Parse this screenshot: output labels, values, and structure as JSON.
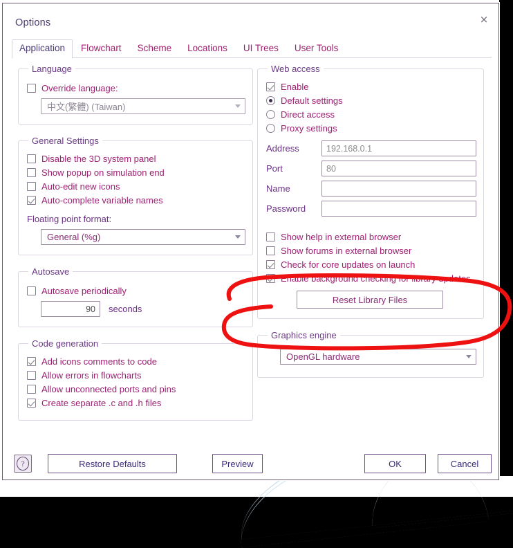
{
  "window": {
    "title": "Options",
    "close_label": "×"
  },
  "tabs": [
    {
      "label": "Application",
      "active": true
    },
    {
      "label": "Flowchart",
      "active": false
    },
    {
      "label": "Scheme",
      "active": false
    },
    {
      "label": "Locations",
      "active": false
    },
    {
      "label": "UI Trees",
      "active": false
    },
    {
      "label": "User Tools",
      "active": false
    }
  ],
  "left": {
    "language": {
      "legend": "Language",
      "override_label": "Override language:",
      "override_checked": false,
      "combo_value": "中文(繁體) (Taiwan)"
    },
    "general": {
      "legend": "General Settings",
      "items": [
        {
          "label": "Disable the 3D system panel",
          "checked": false
        },
        {
          "label": "Show popup on simulation end",
          "checked": false
        },
        {
          "label": "Auto-edit new icons",
          "checked": false
        },
        {
          "label": "Auto-complete variable names",
          "checked": true
        }
      ],
      "float_label": "Floating point format:",
      "float_value": "General (%g)"
    },
    "autosave": {
      "legend": "Autosave",
      "periodic_label": "Autosave periodically",
      "periodic_checked": false,
      "seconds_value": "90",
      "seconds_label": "seconds"
    },
    "codegen": {
      "legend": "Code generation",
      "items": [
        {
          "label": "Add icons comments to code",
          "checked": true
        },
        {
          "label": "Allow errors in flowcharts",
          "checked": false
        },
        {
          "label": "Allow unconnected ports and pins",
          "checked": false
        },
        {
          "label": "Create separate .c and .h files",
          "checked": true
        }
      ]
    }
  },
  "right": {
    "web": {
      "legend": "Web access",
      "enable_label": "Enable",
      "enable_checked": true,
      "radios": [
        {
          "label": "Default settings",
          "selected": true
        },
        {
          "label": "Direct access",
          "selected": false
        },
        {
          "label": "Proxy settings",
          "selected": false
        }
      ],
      "fields": [
        {
          "label": "Address",
          "value": "192.168.0.1",
          "placeholder_style": true
        },
        {
          "label": "Port",
          "value": "80",
          "placeholder_style": true
        },
        {
          "label": "Name",
          "value": "",
          "placeholder_style": false
        },
        {
          "label": "Password",
          "value": "",
          "placeholder_style": false
        }
      ],
      "checks": [
        {
          "label": "Show help in external browser",
          "checked": false
        },
        {
          "label": "Show forums in external browser",
          "checked": false
        },
        {
          "label": "Check for core updates on launch",
          "checked": true
        },
        {
          "label": "Enable background checking for library updates",
          "checked": true
        }
      ],
      "reset_button": "Reset Library Files"
    },
    "graphics": {
      "legend": "Graphics engine",
      "value": "OpenGL hardware"
    }
  },
  "footer": {
    "help_glyph": "?",
    "restore": "Restore Defaults",
    "preview": "Preview",
    "ok": "OK",
    "cancel": "Cancel"
  },
  "annotation": {
    "color": "#ee1111",
    "shape": "hand-drawn-ellipse"
  }
}
